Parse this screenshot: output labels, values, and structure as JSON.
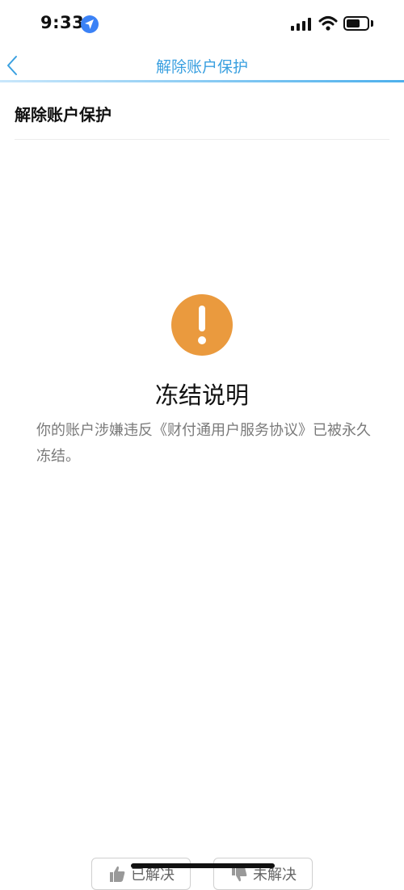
{
  "status_bar": {
    "time": "9:33",
    "icons": [
      "location-arrow-icon",
      "cellular-signal-icon",
      "wifi-icon",
      "battery-icon"
    ]
  },
  "nav": {
    "title": "解除账户保护",
    "back_icon": "chevron-left-icon",
    "accent_color": "#3aa0e0"
  },
  "section": {
    "heading": "解除账户保护"
  },
  "notice": {
    "icon": "exclamation-icon",
    "icon_color": "#ea9a3e",
    "title": "冻结说明",
    "body": "你的账户涉嫌违反《财付通用户服务协议》已被永久冻结。"
  },
  "feedback": {
    "resolved_label": "已解决",
    "unresolved_label": "未解决",
    "resolved_icon": "thumbs-up-icon",
    "unresolved_icon": "thumbs-down-icon"
  }
}
